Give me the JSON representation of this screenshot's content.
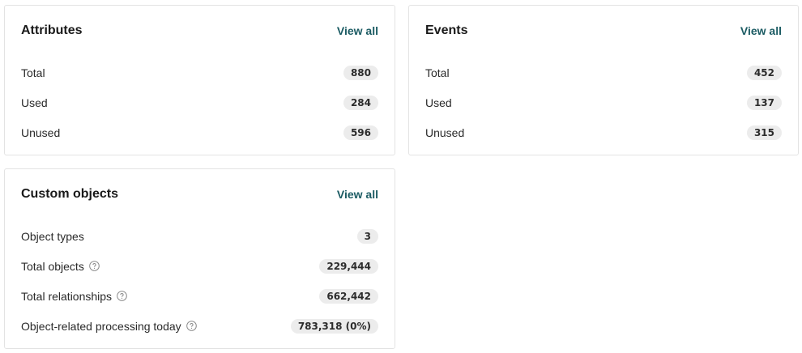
{
  "attributes": {
    "title": "Attributes",
    "view_all": "View all",
    "rows": [
      {
        "label": "Total",
        "value": "880"
      },
      {
        "label": "Used",
        "value": "284"
      },
      {
        "label": "Unused",
        "value": "596"
      }
    ]
  },
  "events": {
    "title": "Events",
    "view_all": "View all",
    "rows": [
      {
        "label": "Total",
        "value": "452"
      },
      {
        "label": "Used",
        "value": "137"
      },
      {
        "label": "Unused",
        "value": "315"
      }
    ]
  },
  "custom_objects": {
    "title": "Custom objects",
    "view_all": "View all",
    "rows": [
      {
        "label": "Object types",
        "value": "3"
      },
      {
        "label": "Total objects",
        "value": "229,444",
        "icon": "help-icon"
      },
      {
        "label": "Total relationships",
        "value": "662,442",
        "icon": "help-icon"
      },
      {
        "label": "Object-related processing today",
        "value": "783,318 (0%)",
        "icon": "help-icon"
      }
    ]
  },
  "colors": {
    "link": "#1b5b63",
    "badge_bg": "#ececec",
    "border": "#e3e3e3"
  }
}
